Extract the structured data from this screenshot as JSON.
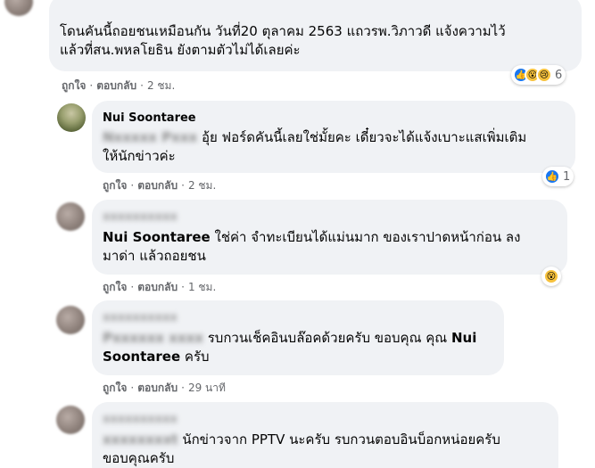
{
  "comments": [
    {
      "author": "",
      "text_lines": [
        "โดนคันนี้ถอยชนเหมือนกัน วันที่20 ตุลาคม 2563 แถวรพ.วิภาวดี แจ้งความไว้",
        "แล้วที่สน.พหลโยธิน ยังตามตัวไม่ได้เลยค่ะ"
      ],
      "like_label": "ถูกใจ",
      "reply_label": "ตอบกลับ",
      "time": "2 ชม.",
      "reactions": {
        "count": "6",
        "icons": [
          "like-icon",
          "wow-icon",
          "sad-icon"
        ]
      }
    },
    {
      "author": "Nui Soontaree",
      "hidden_name": "Nxxxxx Pxxx",
      "line1": "อุ้ย ฟอร์ดคันนี้เลยใช่มั้ยคะ เดี๋ยวจะได้แจ้งเบาะแสเพิ่มเติม",
      "line2": "ให้นักข่าวค่ะ",
      "like_label": "ถูกใจ",
      "reply_label": "ตอบกลับ",
      "time": "2 ชม.",
      "reactions": {
        "count": "1",
        "icons": [
          "like-icon"
        ]
      }
    },
    {
      "author": "xxxxxxxxxx",
      "mention": "Nui Soontaree",
      "line1_rest": " ใช่ค่า จำทะเบียนได้แม่นมาก ของเราปาดหน้าก่อน ลง",
      "line2": "มาด่า แล้วถอยชน",
      "like_label": "ถูกใจ",
      "reply_label": "ตอบกลับ",
      "time": "1 ชม.",
      "reactions": {
        "count": "",
        "icons": [
          "wow-icon"
        ]
      }
    },
    {
      "author": "xxxxxxxxxx",
      "hidden_name": "Pxxxxxx xxxx",
      "line1_rest": " รบกวนเช็คอินบล๊อคด้วยครับ ขอบคุณ คุณ ",
      "mention1": "Nui",
      "mention2": "Soontaree",
      "line2_rest": " ครับ",
      "like_label": "ถูกใจ",
      "reply_label": "ตอบกลับ",
      "time": "29 นาที"
    },
    {
      "author": "xxxxxxxxxx",
      "hidden_name": "xxxxxxxxt",
      "line1_rest": " นักข่าวจาก PPTV นะครับ รบกวนตอบอินบ็อกหน่อยครับ",
      "line2": "ขอบคุณครับ"
    }
  ],
  "colors": {
    "like": "#1877f2",
    "wow": "#f7c23d",
    "bubble": "#f0f2f5",
    "meta": "#65676b"
  }
}
